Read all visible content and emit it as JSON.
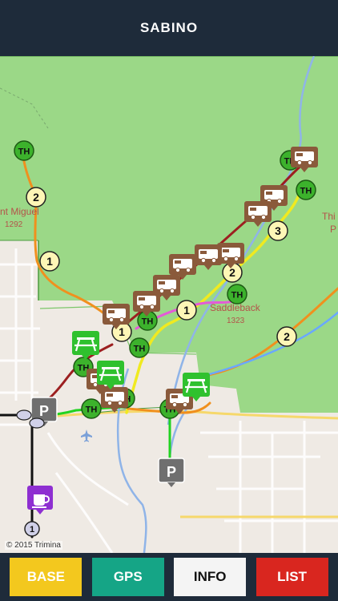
{
  "header": {
    "title": "SABINO"
  },
  "map": {
    "attribution": "© 2015 Trimina",
    "places": [
      {
        "name": "Mount Miguel",
        "shown": "nt Miguel",
        "elev": "1292"
      },
      {
        "name": "Saddleback",
        "elev": "1323"
      },
      {
        "name": "Thimble Peak",
        "shown_lines": [
          "Thi",
          "P"
        ]
      }
    ],
    "trail_markers": [
      "1",
      "2",
      "1",
      "2",
      "1",
      "3",
      "2",
      "1"
    ],
    "trailhead_label": "TH",
    "parking_label": "P",
    "colors": {
      "park": "#9bd887",
      "urban": "#efeae4",
      "stream": "#8fb4e8",
      "trail_orange": "#f0901e",
      "trail_yellow": "#f0ea20",
      "trail_magenta": "#e45ad8",
      "trail_darkred": "#9c1f20",
      "trail_green": "#21d321",
      "trail_blue": "#6aa8ff",
      "road": "#f6d86b",
      "trailhead": "#3cb22c",
      "camping": "#8a5a3b",
      "picnic": "#2fc12e",
      "parking": "#6f6f6f",
      "cafe": "#8e2fd1"
    },
    "icons": [
      "campground-icon",
      "picnic-table-icon",
      "parking-icon",
      "coffee-icon",
      "trailhead-icon"
    ]
  },
  "nav": {
    "base": "BASE",
    "gps": "GPS",
    "info": "INFO",
    "list": "LIST"
  }
}
